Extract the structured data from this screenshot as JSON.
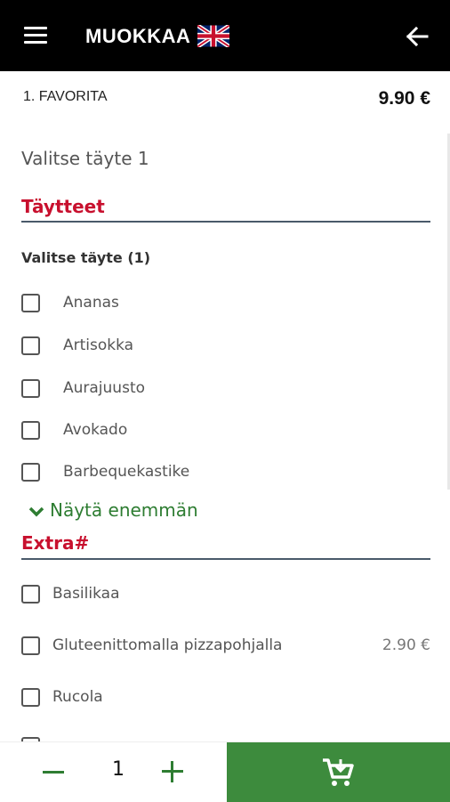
{
  "header": {
    "title": "MUOKKAA",
    "menu_icon": "hamburger-menu-icon",
    "language_icon": "uk-flag-icon",
    "back_icon": "arrow-left-icon"
  },
  "product": {
    "name": "1. FAVORITA",
    "price": "9.90 €"
  },
  "select_heading": "Valitse täyte 1",
  "sections": {
    "fillings": {
      "title": "Täytteet",
      "group_label": "Valitse täyte (1)",
      "options": [
        "Ananas",
        "Artisokka",
        "Aurajuusto",
        "Avokado",
        "Barbequekastike"
      ],
      "show_more": "Näytä enemmän"
    },
    "extras": {
      "title": "Extra#",
      "options": [
        {
          "label": "Basilikaa",
          "price": ""
        },
        {
          "label": "Gluteenittomalla pizzapohjalla",
          "price": "2.90 €"
        },
        {
          "label": "Rucola",
          "price": ""
        }
      ]
    }
  },
  "quantity": {
    "value": "1"
  },
  "colors": {
    "accent_red": "#c8102e",
    "accent_green": "#2e7d32",
    "cart_button": "#3d8b3d",
    "header_bg": "#000000"
  }
}
